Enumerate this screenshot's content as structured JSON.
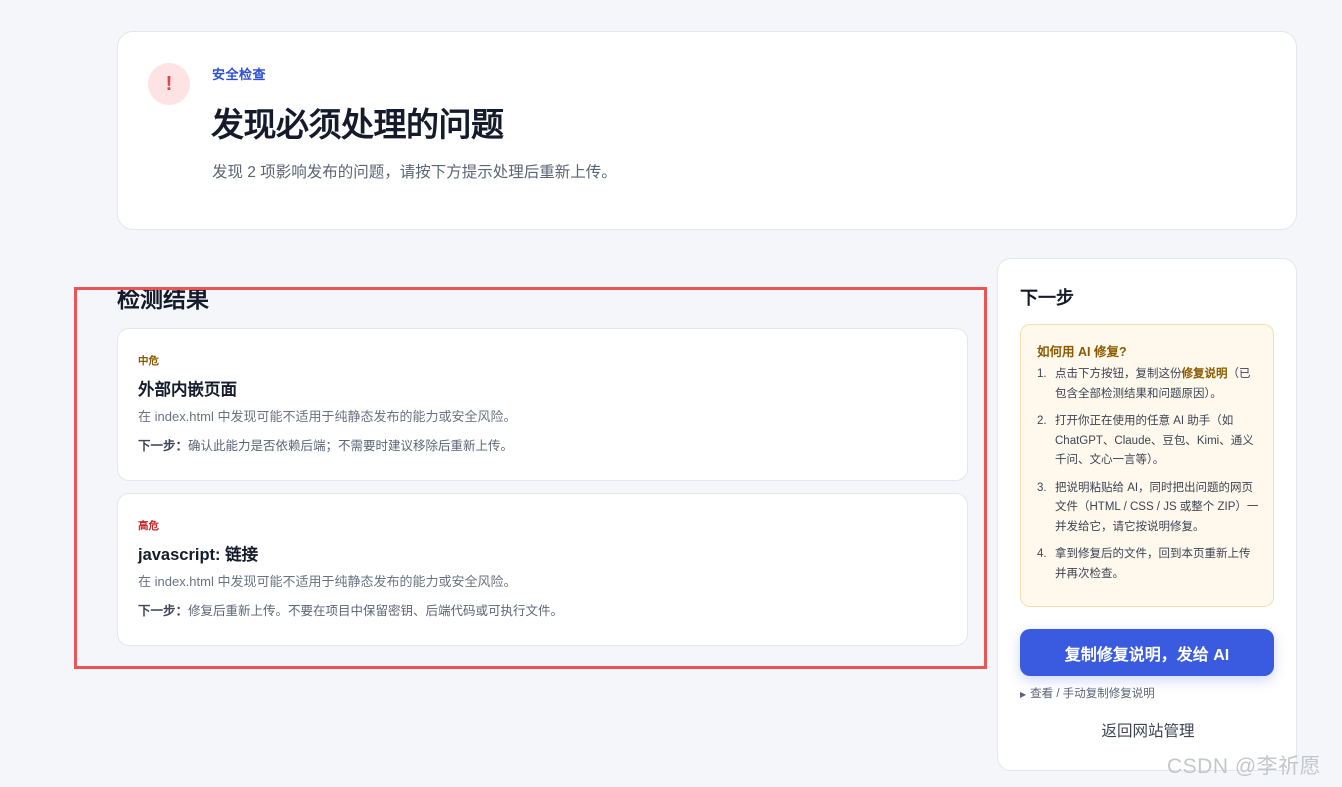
{
  "header": {
    "icon": "exclamation-icon",
    "icon_glyph": "!",
    "eyebrow": "安全检查",
    "title": "发现必须处理的问题",
    "subtitle": "发现 2 项影响发布的问题，请按下方提示处理后重新上传。"
  },
  "results": {
    "title": "检测结果",
    "items": [
      {
        "severity": "中危",
        "title": "外部内嵌页面",
        "description": "在 index.html 中发现可能不适用于纯静态发布的能力或安全风险。",
        "next_label": "下一步：",
        "next_text": "确认此能力是否依赖后端；不需要时建议移除后重新上传。"
      },
      {
        "severity": "高危",
        "title": "javascript: 链接",
        "description": "在 index.html 中发现可能不适用于纯静态发布的能力或安全风险。",
        "next_label": "下一步：",
        "next_text": "修复后重新上传。不要在项目中保留密钥、后端代码或可执行文件。"
      }
    ]
  },
  "side": {
    "title": "下一步",
    "howto_title": "如何用 AI 修复?",
    "steps": [
      {
        "num": "1.",
        "pre": "点击下方按钮，复制这份",
        "bold": "修复说明",
        "post": "（已包含全部检测结果和问题原因）。"
      },
      {
        "num": "2.",
        "pre": "打开你正在使用的任意 AI 助手（如 ChatGPT、Claude、豆包、Kimi、通义千问、文心一言等）。",
        "bold": "",
        "post": ""
      },
      {
        "num": "3.",
        "pre": "把说明粘贴给 AI，同时把出问题的网页文件（HTML / CSS / JS 或整个 ZIP）一并发给它，请它按说明修复。",
        "bold": "",
        "post": ""
      },
      {
        "num": "4.",
        "pre": "拿到修复后的文件，回到本页重新上传并再次检查。",
        "bold": "",
        "post": ""
      }
    ],
    "copy_button": "复制修复说明，发给 AI",
    "manual_toggle": "查看 / 手动复制修复说明",
    "back_link": "返回网站管理"
  },
  "watermark": "CSDN @李祈愿",
  "colors": {
    "accent": "#3a5be0",
    "highlight_border": "#ea5455",
    "severity_medium": "#8a5a00",
    "severity_high": "#c62828"
  }
}
